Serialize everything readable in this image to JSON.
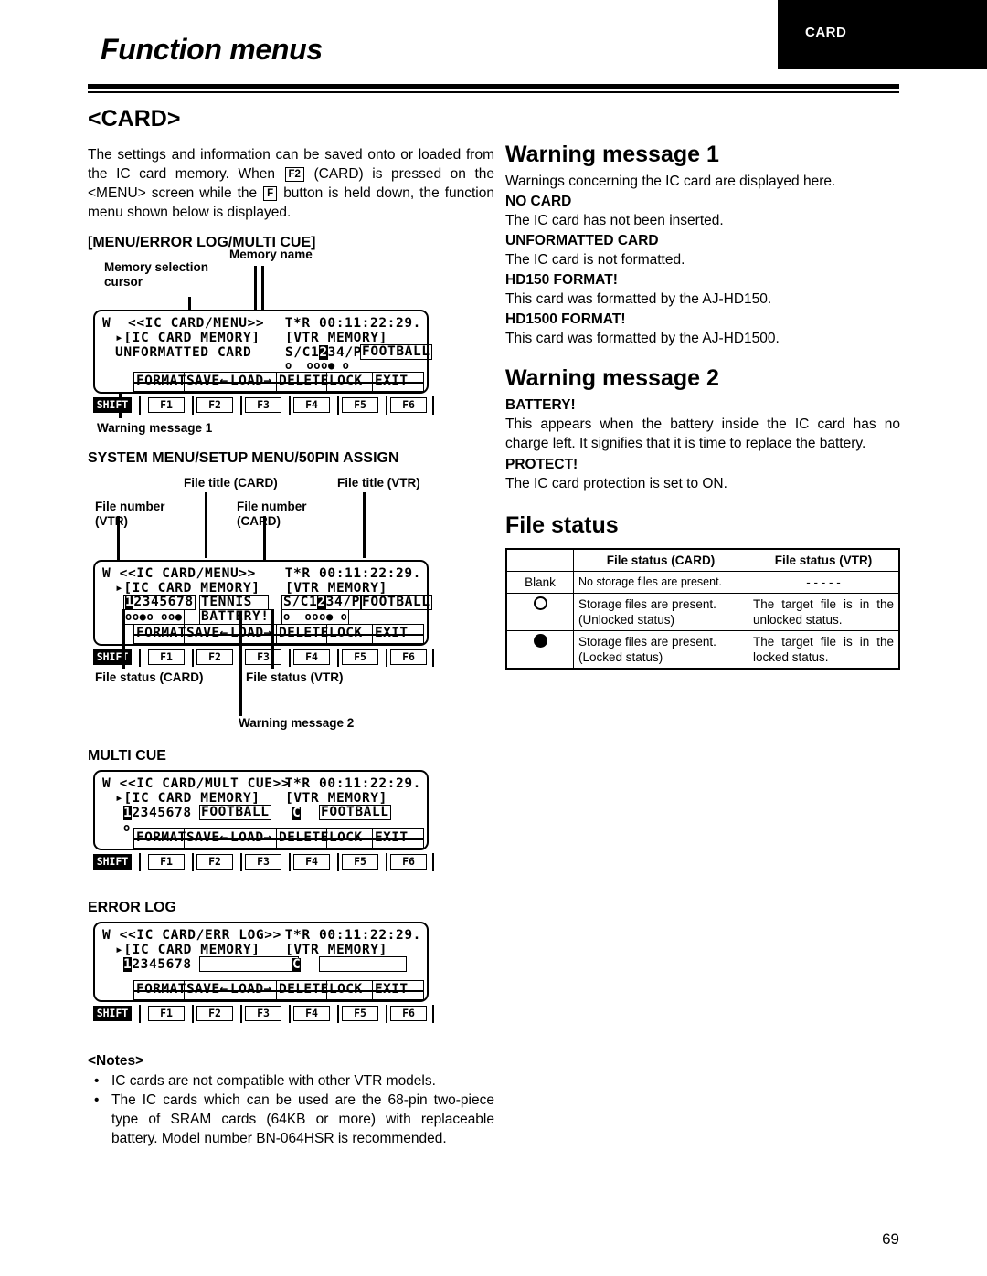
{
  "header": {
    "title": "Function menus",
    "tab_label": "CARD"
  },
  "page_number": "69",
  "left": {
    "section_title": "<CARD>",
    "intro_parts": {
      "p1": "The settings and information can be saved onto or loaded from the IC card memory.  When ",
      "key1": "F2",
      "p2": " (CARD) is pressed on the <MENU> screen while the ",
      "key2": "F",
      "p3": " button is held down, the function menu shown below is displayed."
    },
    "diagram1": {
      "heading": "[MENU/ERROR LOG/MULTI CUE]",
      "callouts": {
        "memory_selection_cursor": "Memory selection\ncursor",
        "memory_name": "Memory name",
        "warning_message_1": "Warning message 1"
      },
      "lcd": {
        "line1_left": "W  <<IC CARD/MENU>>",
        "line1_right": "T*R 00:11:22:29.",
        "line2_left": "▸[IC CARD MEMORY]",
        "line2_right": "[VTR MEMORY]",
        "line3_left": "UNFORMATTED CARD",
        "line3_vtr_a": "S/C1",
        "line3_vtr_hl": "2",
        "line3_vtr_b": "34/P",
        "line3_vtr_title": "FOOTBALL",
        "dots_vtr": "o  ooo● o",
        "fkeys": [
          "FORMAT",
          "SAVE←",
          "LOAD→",
          "DELETE",
          "LOCK",
          "EXIT"
        ],
        "keystrip": [
          "SHIFT",
          "F1",
          "F2",
          "F3",
          "F4",
          "F5",
          "F6"
        ]
      }
    },
    "diagram2": {
      "heading": "SYSTEM MENU/SETUP MENU/50PIN ASSIGN",
      "callouts": {
        "file_number_vtr": "File number\n(VTR)",
        "file_title_card": "File title (CARD)",
        "file_number_card": "File number\n(CARD)",
        "file_title_vtr": "File title (VTR)",
        "file_status_card": "File status (CARD)",
        "file_status_vtr": "File status (VTR)",
        "warning_message_2": "Warning message 2"
      },
      "lcd": {
        "line1_left": "W <<IC CARD/MENU>>",
        "line1_right": "T*R 00:11:22:29.",
        "line2_left": "▸[IC CARD MEMORY]",
        "line2_right": "[VTR MEMORY]",
        "card_num_hl": "1",
        "card_num_rest": "2345678",
        "card_title": "TENNIS",
        "card_dots": "oo●o oo●",
        "card_warning": "BATTERY!",
        "vtr_num_a": "S/C1",
        "vtr_num_hl": "2",
        "vtr_num_b": "34/P",
        "vtr_title": "FOOTBALL",
        "vtr_dots": "o  ooo● o",
        "fkeys": [
          "FORMAT",
          "SAVE←",
          "LOAD→",
          "DELETE",
          "LOCK",
          "EXIT"
        ],
        "keystrip": [
          "SHIFT",
          "F1",
          "F2",
          "F3",
          "F4",
          "F5",
          "F6"
        ]
      }
    },
    "diagram3": {
      "heading": "MULTI CUE",
      "lcd": {
        "line1_left": "W <<IC CARD/MULT CUE>>",
        "line1_right": "T*R 00:11:22:29.",
        "line2_left": "▸[IC CARD MEMORY]",
        "line2_right": "[VTR MEMORY]",
        "card_num_hl": "1",
        "card_num_rest": "2345678",
        "card_title": "FOOTBALL",
        "card_dots": "o",
        "vtr_mark": "C",
        "vtr_title": "FOOTBALL",
        "fkeys": [
          "FORMAT",
          "SAVE←",
          "LOAD→",
          "DELETE",
          "LOCK",
          "EXIT"
        ],
        "keystrip": [
          "SHIFT",
          "F1",
          "F2",
          "F3",
          "F4",
          "F5",
          "F6"
        ]
      }
    },
    "diagram4": {
      "heading": "ERROR LOG",
      "lcd": {
        "line1_left": "W <<IC CARD/ERR LOG>>",
        "line1_right": "T*R 00:11:22:29.",
        "line2_left": "▸[IC CARD MEMORY]",
        "line2_right": "[VTR MEMORY]",
        "card_num_hl": "1",
        "card_num_rest": "2345678",
        "card_title": "",
        "vtr_mark": "C",
        "vtr_title": "",
        "fkeys": [
          "FORMAT",
          "SAVE←",
          "LOAD→",
          "DELETE",
          "LOCK",
          "EXIT"
        ],
        "keystrip": [
          "SHIFT",
          "F1",
          "F2",
          "F3",
          "F4",
          "F5",
          "F6"
        ]
      }
    },
    "notes": {
      "title": "<Notes>",
      "bullet": "•",
      "items": [
        "IC cards are not compatible with other VTR models.",
        "The IC cards which can be used are the 68-pin two-piece type of SRAM cards (64KB or more) with replaceable battery.  Model number BN-064HSR is recommended."
      ]
    }
  },
  "right": {
    "warning1": {
      "title": "Warning message 1",
      "intro": "Warnings concerning the IC card are displayed here.",
      "entries": [
        {
          "term": "NO CARD",
          "desc": "The IC card has not been inserted."
        },
        {
          "term": "UNFORMATTED CARD",
          "desc": "The IC card is not formatted."
        },
        {
          "term": "HD150 FORMAT!",
          "desc": "This card was formatted by the AJ-HD150."
        },
        {
          "term": "HD1500 FORMAT!",
          "desc": "This card was formatted by the AJ-HD1500."
        }
      ]
    },
    "warning2": {
      "title": "Warning message 2",
      "entries": [
        {
          "term": "BATTERY!",
          "desc": "This appears when the battery inside the IC card has no charge left.  It signifies that it is time to replace the battery."
        },
        {
          "term": "PROTECT!",
          "desc": "The IC card protection is set to ON."
        }
      ]
    },
    "file_status": {
      "title": "File status",
      "columns": [
        "",
        "File status (CARD)",
        "File status (VTR)"
      ],
      "rows": [
        {
          "mark": "Blank",
          "mark_type": "text",
          "card": "No storage files are present.",
          "vtr": "- - - - -"
        },
        {
          "mark": "",
          "mark_type": "circle-outline",
          "card": "Storage files are present. (Unlocked status)",
          "vtr": "The target file is in the unlocked status."
        },
        {
          "mark": "",
          "mark_type": "circle-filled",
          "card": "Storage files are present. (Locked status)",
          "vtr": "The target file is in the locked status."
        }
      ]
    }
  }
}
